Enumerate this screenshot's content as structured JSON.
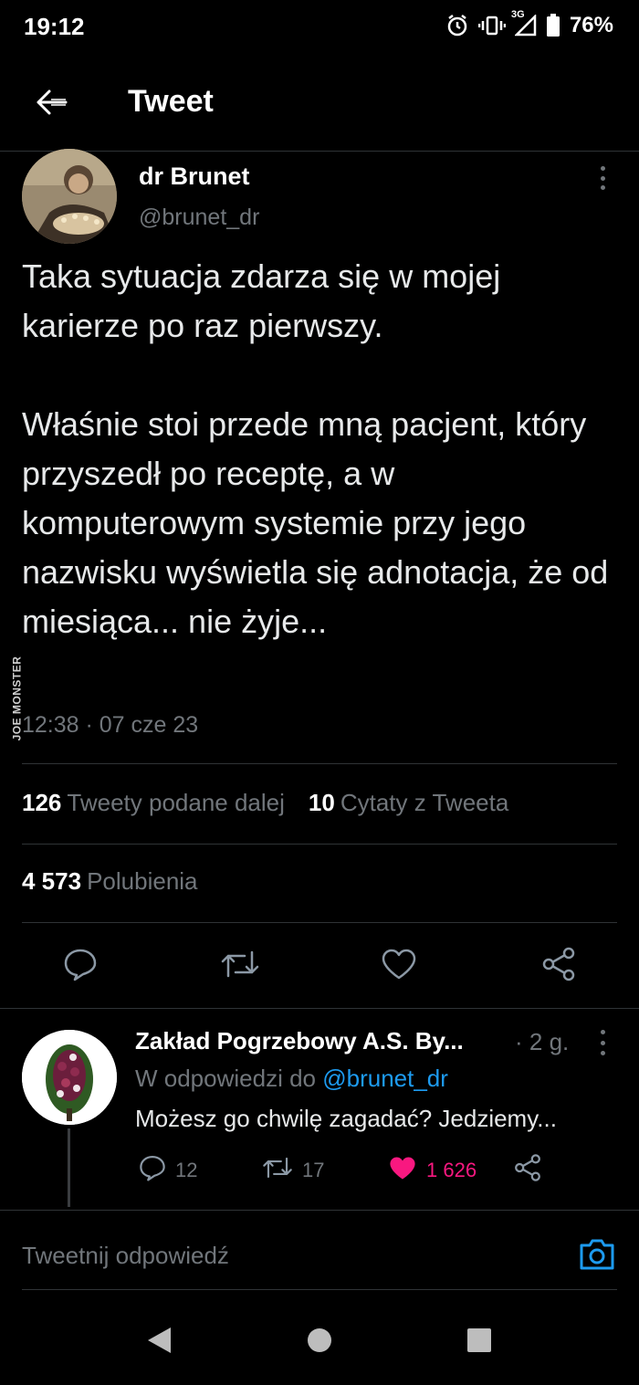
{
  "status_bar": {
    "time": "19:12",
    "network": "3G",
    "battery": "76%"
  },
  "header": {
    "title": "Tweet",
    "back_icon": "arrow-left-icon"
  },
  "tweet": {
    "author_name": "dr Brunet",
    "author_handle": "@brunet_dr",
    "text": "Taka sytuacja zdarza się w mojej karierze po raz pierwszy.\n\nWłaśnie stoi przede mną pacjent, który przyszedł po receptę, a w komputerowym systemie przy jego nazwisku wyświetla się adnotacja, że od miesiąca... nie żyje...",
    "timestamp": "12:38 · 07 cze 23",
    "watermark": "JOE MONSTER"
  },
  "stats": {
    "retweets_count": "126",
    "retweets_label": "Tweety podane dalej",
    "quotes_count": "10",
    "quotes_label": "Cytaty z Tweeta",
    "likes_count": "4 573",
    "likes_label": "Polubienia"
  },
  "actions": [
    "reply-icon",
    "retweet-icon",
    "like-icon",
    "share-icon"
  ],
  "reply": {
    "author_name": "Zakład Pogrzebowy A.S. By...",
    "time": "· 2 g.",
    "context_prefix": "W odpowiedzi do",
    "context_mention": "@brunet_dr",
    "text": "Możesz go chwilę zagadać? Jedziemy...",
    "reply_count": "12",
    "retweet_count": "17",
    "like_count": "1 626"
  },
  "composer": {
    "placeholder": "Tweetnij odpowiedź"
  },
  "colors": {
    "background": "#000000",
    "text": "#e7e9ea",
    "secondary": "#71767b",
    "accent": "#1d9bf0",
    "like": "#f91880"
  }
}
